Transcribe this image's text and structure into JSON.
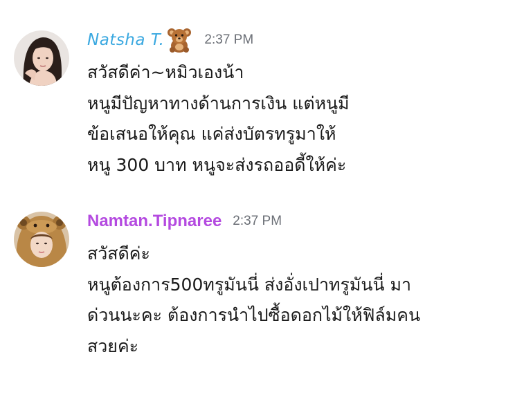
{
  "messages": [
    {
      "author": "Natsha T.",
      "author_color": "#3aa8e0",
      "author_icon": "teddy-bear-icon",
      "time": "2:37 PM",
      "lines": [
        "สวัสดีค่า~หมิวเองน้า",
        "หนูมีปัญหาทางด้านการเงิน แต่หนูมี",
        "ข้อเสนอให้คุณ แค่ส่งบัตรทรูมาให้",
        "หนู 300 บาท หนูจะส่งรถออดี้ให้ค่ะ"
      ]
    },
    {
      "author": "Namtan.Tipnaree",
      "author_color": "#b44ae0",
      "time": "2:37 PM",
      "lines": [
        "สวัสดีค่ะ",
        "หนูต้องการ500ทรูมันนี่ ส่งอั่งเปาทรูมันนี่ มา",
        "ด่วนนะคะ ต้องการนำไปซื้อดอกไม้ให้ฟิล์มคน",
        "สวยค่ะ"
      ]
    }
  ]
}
